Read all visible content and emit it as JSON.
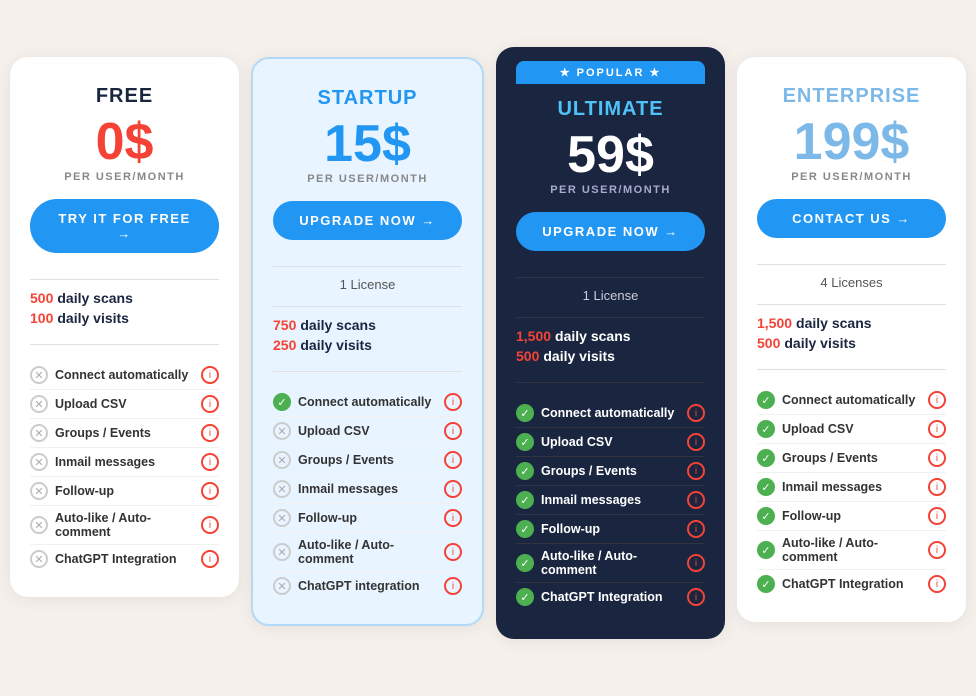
{
  "plans": [
    {
      "id": "free",
      "name": "FREE",
      "price": "0$",
      "per_user": "PER USER/MONTH",
      "cta_label": "TRY IT FOR FREE →",
      "license": null,
      "daily_scans": "500",
      "daily_visits": "100",
      "scans_label": "daily scans",
      "visits_label": "daily visits",
      "features": [
        {
          "name": "Connect automatically",
          "checked": false
        },
        {
          "name": "Upload CSV",
          "checked": false
        },
        {
          "name": "Groups / Events",
          "checked": false
        },
        {
          "name": "Inmail messages",
          "checked": false
        },
        {
          "name": "Follow-up",
          "checked": false
        },
        {
          "name": "Auto-like / Auto-comment",
          "checked": false
        },
        {
          "name": "ChatGPT Integration",
          "checked": false
        }
      ]
    },
    {
      "id": "startup",
      "name": "STARTUP",
      "price": "15$",
      "per_user": "PER USER/MONTH",
      "cta_label": "UPGRADE NOW →",
      "license": "1 License",
      "daily_scans": "750",
      "daily_visits": "250",
      "scans_label": "daily scans",
      "visits_label": "daily visits",
      "features": [
        {
          "name": "Connect automatically",
          "checked": true
        },
        {
          "name": "Upload CSV",
          "checked": false
        },
        {
          "name": "Groups / Events",
          "checked": false
        },
        {
          "name": "Inmail messages",
          "checked": false
        },
        {
          "name": "Follow-up",
          "checked": false
        },
        {
          "name": "Auto-like / Auto-comment",
          "checked": false
        },
        {
          "name": "ChatGPT integration",
          "checked": false
        }
      ]
    },
    {
      "id": "ultimate",
      "name": "ULTIMATE",
      "price": "59$",
      "per_user": "PER USER/MONTH",
      "cta_label": "UPGRADE NOW →",
      "license": "1 License",
      "daily_scans": "1,500",
      "daily_visits": "500",
      "scans_label": "daily scans",
      "visits_label": "daily visits",
      "popular": true,
      "popular_label": "★  POPULAR  ★",
      "features": [
        {
          "name": "Connect automatically",
          "checked": true
        },
        {
          "name": "Upload CSV",
          "checked": true
        },
        {
          "name": "Groups / Events",
          "checked": true
        },
        {
          "name": "Inmail messages",
          "checked": true
        },
        {
          "name": "Follow-up",
          "checked": true
        },
        {
          "name": "Auto-like / Auto-comment",
          "checked": true
        },
        {
          "name": "ChatGPT Integration",
          "checked": true
        }
      ]
    },
    {
      "id": "enterprise",
      "name": "ENTERPRISE",
      "price": "199$",
      "per_user": "PER USER/MONTH",
      "cta_label": "CONTACT US →",
      "license": "4 Licenses",
      "daily_scans": "1,500",
      "daily_visits": "500",
      "scans_label": "daily scans",
      "visits_label": "daily visits",
      "features": [
        {
          "name": "Connect automatically",
          "checked": true
        },
        {
          "name": "Upload CSV",
          "checked": true
        },
        {
          "name": "Groups / Events",
          "checked": true
        },
        {
          "name": "Inmail messages",
          "checked": true
        },
        {
          "name": "Follow-up",
          "checked": true
        },
        {
          "name": "Auto-like / Auto-comment",
          "checked": true
        },
        {
          "name": "ChatGPT Integration",
          "checked": true
        }
      ]
    }
  ]
}
